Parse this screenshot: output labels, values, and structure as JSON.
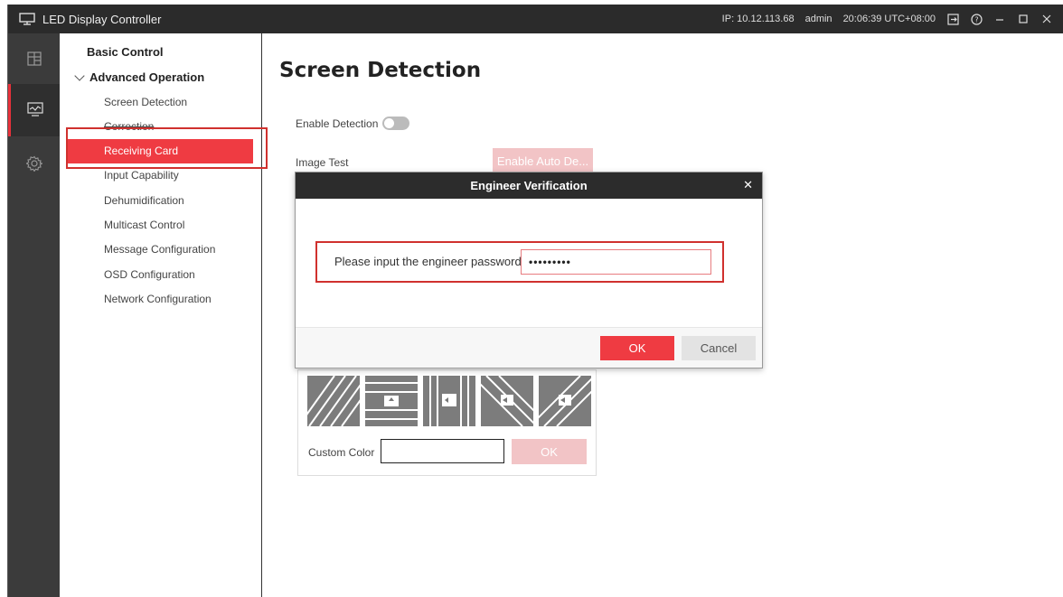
{
  "titlebar": {
    "app_title": "LED Display Controller",
    "ip": "IP: 10.12.113.68",
    "user": "admin",
    "time": "20:06:39 UTC+08:00"
  },
  "rail": {
    "items": [
      {
        "icon": "layout-icon"
      },
      {
        "icon": "monitor-icon",
        "active": true
      },
      {
        "icon": "gear-icon"
      }
    ]
  },
  "nav": {
    "basic_control": "Basic Control",
    "advanced_operation": "Advanced Operation",
    "items": [
      {
        "label": "Screen Detection"
      },
      {
        "label": "Correction"
      },
      {
        "label": "Receiving Card",
        "active": true
      },
      {
        "label": "Input Capability"
      },
      {
        "label": "Dehumidification"
      },
      {
        "label": "Multicast Control"
      },
      {
        "label": "Message Configuration"
      },
      {
        "label": "OSD Configuration"
      },
      {
        "label": "Network Configuration"
      }
    ]
  },
  "main": {
    "title": "Screen Detection",
    "enable_detection_label": "Enable Detection",
    "image_test_label": "Image Test",
    "enable_auto_detect_button": "Enable Auto De...",
    "custom_color_label": "Custom Color",
    "custom_color_value": "",
    "custom_ok_button": "OK"
  },
  "dialog": {
    "title": "Engineer Verification",
    "password_label": "Please input the engineer password",
    "password_value": "•••••••••",
    "ok_button": "OK",
    "cancel_button": "Cancel"
  },
  "colors": {
    "accent": "#ef3b42",
    "titlebar_bg": "#2b2b2b",
    "rail_bg": "#3b3b3b",
    "highlight_border": "#d0312e"
  }
}
